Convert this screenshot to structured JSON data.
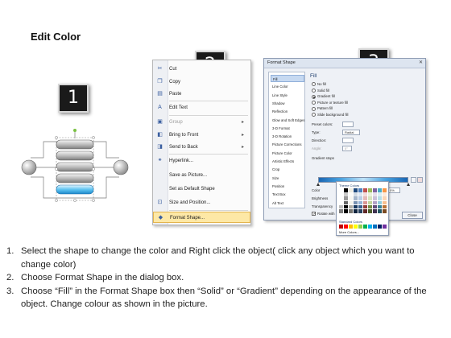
{
  "page": {
    "title": "Edit Color"
  },
  "badges": [
    "1",
    "2",
    "3"
  ],
  "context_menu": {
    "items": [
      {
        "label": "Cut",
        "icon": "scissors-icon",
        "glyph": "✂",
        "enabled": true,
        "submenu": false,
        "highlighted": false
      },
      {
        "label": "Copy",
        "icon": "copy-icon",
        "glyph": "❐",
        "enabled": true,
        "submenu": false,
        "highlighted": false
      },
      {
        "label": "Paste",
        "icon": "paste-icon",
        "glyph": "▤",
        "enabled": true,
        "submenu": false,
        "highlighted": false
      },
      {
        "label": "Edit Text",
        "icon": "edit-text-icon",
        "glyph": "A",
        "enabled": true,
        "submenu": false,
        "highlighted": false
      },
      {
        "label": "Group",
        "icon": "group-icon",
        "glyph": "▣",
        "enabled": false,
        "submenu": true,
        "highlighted": false
      },
      {
        "label": "Bring to Front",
        "icon": "bring-to-front-icon",
        "glyph": "◧",
        "enabled": true,
        "submenu": true,
        "highlighted": false
      },
      {
        "label": "Send to Back",
        "icon": "send-to-back-icon",
        "glyph": "◨",
        "enabled": true,
        "submenu": true,
        "highlighted": false
      },
      {
        "label": "Hyperlink...",
        "icon": "hyperlink-icon",
        "glyph": "⚭",
        "enabled": true,
        "submenu": false,
        "highlighted": false
      },
      {
        "label": "Save as Picture...",
        "icon": "",
        "glyph": "",
        "enabled": true,
        "submenu": false,
        "highlighted": false
      },
      {
        "label": "Set as Default Shape",
        "icon": "",
        "glyph": "",
        "enabled": true,
        "submenu": false,
        "highlighted": false
      },
      {
        "label": "Size and Position...",
        "icon": "size-position-icon",
        "glyph": "⊡",
        "enabled": true,
        "submenu": false,
        "highlighted": false
      },
      {
        "label": "Format Shape...",
        "icon": "format-shape-icon",
        "glyph": "◆",
        "enabled": true,
        "submenu": false,
        "highlighted": true
      }
    ]
  },
  "dialog": {
    "title": "Format Shape",
    "close_glyph": "✕",
    "nav": [
      "Fill",
      "Line Color",
      "Line Style",
      "Shadow",
      "Reflection",
      "Glow and Soft Edges",
      "3-D Format",
      "3-D Rotation",
      "Picture Corrections",
      "Picture Color",
      "Artistic Effects",
      "Crop",
      "Size",
      "Position",
      "Text Box",
      "Alt Text"
    ],
    "selected_nav": "Fill",
    "fill_heading": "Fill",
    "fill_options": [
      "No fill",
      "Solid fill",
      "Gradient fill",
      "Picture or texture fill",
      "Pattern fill",
      "Slide background fill"
    ],
    "selected_fill": "Gradient fill",
    "preset_colors_label": "Preset colors:",
    "type_label": "Type:",
    "type_value": "Radial",
    "direction_label": "Direction:",
    "angle_label": "Angle:",
    "angle_value": "0°",
    "gradient_stops_label": "Gradient stops",
    "color_label": "Color",
    "position_label": "Position:",
    "position_value": "0%",
    "brightness_label": "Brightness",
    "transparency_label": "Transparency",
    "rotate_label": "Rotate with shape",
    "close_button": "Close"
  },
  "palette": {
    "theme_label": "Theme Colors",
    "standard_label": "Standard Colors",
    "more_label": "More Colors...",
    "theme_top": [
      "#ffffff",
      "#000000",
      "#eeece1",
      "#1f497d",
      "#4f81bd",
      "#c0504d",
      "#9bbb59",
      "#8064a2",
      "#4bacc6",
      "#f79646"
    ],
    "standard": [
      "#c00000",
      "#ff0000",
      "#ffc000",
      "#ffff00",
      "#92d050",
      "#00b050",
      "#00b0f0",
      "#0070c0",
      "#002060",
      "#7030a0"
    ]
  },
  "instructions": [
    {
      "num": "1.",
      "text": "Select the shape to change the color and Right click the object( click any object which you want to change color)"
    },
    {
      "num": "2.",
      "text": "Choose Format Shape in the dialog box."
    },
    {
      "num": "3.",
      "text": "Choose “Fill” in the Format Shape box then “Solid” or “Gradient” depending on the appearance of the object. Change colour as shown in the picture."
    }
  ]
}
